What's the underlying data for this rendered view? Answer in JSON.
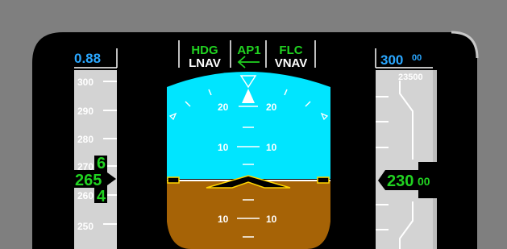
{
  "colors": {
    "background": "#7f7f7f",
    "display": "#000000",
    "sky": "#00e5ff",
    "ground": "#a66306",
    "tape": "#d3d3d3",
    "mode_green": "#21d321",
    "cyan_readout": "#2aa7ff",
    "aircraft_symbol": "#ffd400",
    "white": "#ffffff"
  },
  "fma": {
    "autothrottle_active": "HDG",
    "autothrottle_armed": "LNAV",
    "autopilot": "AP1",
    "autopilot_icon": "left-arrow-icon",
    "vertical_active": "FLC",
    "vertical_armed": "VNAV"
  },
  "speed_tape": {
    "selected_mach": "0.88",
    "ticks": [
      "300",
      "290",
      "280",
      "270",
      "260",
      "250"
    ],
    "current_speed": "265",
    "trend_upper_digit": "6",
    "trend_lower_digit": "4"
  },
  "altitude_tape": {
    "selected_altitude_main": "300",
    "selected_altitude_sub": "00",
    "top_label": "23500",
    "current_altitude_main": "230",
    "current_altitude_sub": "00"
  },
  "attitude": {
    "pitch_up": [
      {
        "left": "20",
        "right": "20"
      },
      {
        "left": "10",
        "right": "10"
      }
    ],
    "pitch_down": [
      {
        "left": "10",
        "right": "10"
      }
    ]
  }
}
